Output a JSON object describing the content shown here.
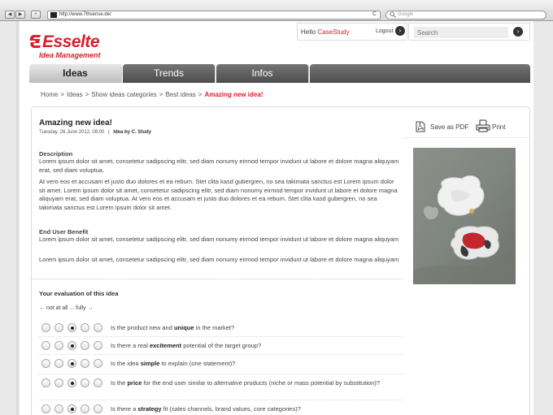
{
  "browser": {
    "nav": {
      "back": "◀",
      "forward": "▶",
      "add": "+"
    },
    "url": "http://www.7thsense.de/",
    "reload": "C",
    "search_placeholder": "Google",
    "search_icon": "search-icon"
  },
  "brand": {
    "name": "Esselte",
    "subtitle": "Idea Management",
    "color": "#d7212b"
  },
  "account": {
    "greeting": "Hello",
    "username": "CaseStudy",
    "logout": "Logout"
  },
  "search": {
    "placeholder": "Search"
  },
  "tabs": [
    {
      "label": "Ideas",
      "active": true
    },
    {
      "label": "Trends",
      "active": false
    },
    {
      "label": "Infos",
      "active": false
    }
  ],
  "breadcrumb": {
    "items": [
      "Home",
      "Ideas",
      "Show ideas categories",
      "Best ideas"
    ],
    "current": "Amazing new idea!",
    "separator": ">"
  },
  "idea": {
    "title": "Amazing new idea!",
    "date": "Tuesday, 26 June 2012, 08:00",
    "meta_sep": "|",
    "author_prefix": "Idea by",
    "author": "C. Study",
    "description_label": "Description",
    "description_p1": "Lorem ipsum dolor sit amet, consetetur sadipscing elitr, sed diam nonumy eirmod tempor invidunt ut labore et dolore magna aliquyam erat, sed diam voluptua.",
    "description_p2": "At vero eos et accusam et justo duo dolores et ea rebum. Stet clita kasd gubergren, no sea takimata sanctus est Lorem ipsum dolor sit amet. Lorem ipsum dolor sit amet, consetetur sadipscing elitr, sed diam nonumy eirmod tempor invidunt ut labore et dolore magna aliquyam erat, sed diam voluptua. At vero eos et accusam et justo duo dolores et ea rebum. Stet clita kasd gubergren, no sea takimata sanctus est Lorem ipsum dolor sit amet.",
    "benefit_label": "End User Benefit",
    "benefit_p1": "Lorem ipsum dolor sit amet, consetetur sadipscing elitr, sed diam nonumy eirmod tempor invidunt ut labore et dolore magna aliquyam",
    "benefit_p2": "Lorem ipsum dolor sit amet, consetetur sadipscing elitr, sed diam nonumy eirmod tempor invidunt ut labore et dolore magna aliquyam"
  },
  "actions": {
    "pdf": "Save as PDF",
    "print": "Print"
  },
  "evaluation": {
    "title": "Your evaluation of this idea",
    "scale": "← not at all ... fully →",
    "questions": [
      {
        "pre": "Is the product new and ",
        "bold": "unique",
        "post": " in the market?",
        "selected": 3
      },
      {
        "pre": "Is there a real ",
        "bold": "excitement",
        "post": " potential of the target group?",
        "selected": 3
      },
      {
        "pre": "Is the idea ",
        "bold": "simple",
        "post": " to explain (one statement)?",
        "selected": 3
      },
      {
        "pre": "Is the ",
        "bold": "price",
        "post": " for the end user similar to alternative products (niche or mass potential by substitution)?",
        "selected": 3
      },
      {
        "pre": "Is there a ",
        "bold": "strategy",
        "post": " fit (sales channels, brand values, core categories)?",
        "selected": 3
      }
    ]
  }
}
